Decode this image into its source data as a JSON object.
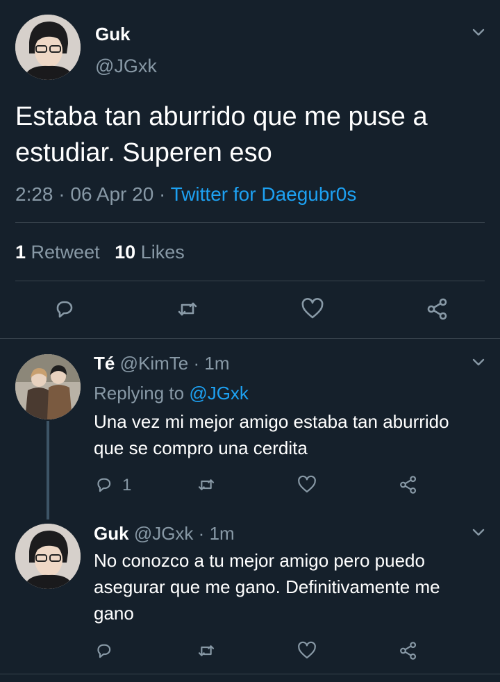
{
  "main_tweet": {
    "display_name": "Guk",
    "handle": "@JGxk",
    "text_line1": "Estaba tan aburrido que me puse a",
    "text_line2": "estudiar. Superen eso",
    "time": "2:28",
    "sep1": "·",
    "date": "06 Apr 20",
    "sep2": "·",
    "source": "Twitter for Daegubr0s",
    "retweet_count": "1",
    "retweet_label": "Retweet",
    "like_count": "10",
    "like_label": "Likes"
  },
  "replies": [
    {
      "display_name": "Té",
      "handle": "@KimTe",
      "sep": "·",
      "time": "1m",
      "replying_prefix": "Replying to",
      "replying_handle": "@JGxk",
      "text_line1": "Una vez mi mejor amigo estaba tan aburrido",
      "text_line2": "que se compro una cerdita",
      "reply_count": "1"
    },
    {
      "display_name": "Guk",
      "handle": "@JGxk",
      "sep": "·",
      "time": "1m",
      "text_line1": "No conozco a tu mejor amigo pero puedo",
      "text_line2": "asegurar que me gano. Definitivamente me",
      "text_line3": "gano"
    }
  ],
  "colors": {
    "background": "#15202b",
    "text": "#ffffff",
    "muted": "#8899a6",
    "accent": "#1da1f2",
    "divider": "#38444d"
  },
  "icons": [
    "chevron-down-icon",
    "reply-icon",
    "retweet-icon",
    "like-icon",
    "share-icon"
  ]
}
